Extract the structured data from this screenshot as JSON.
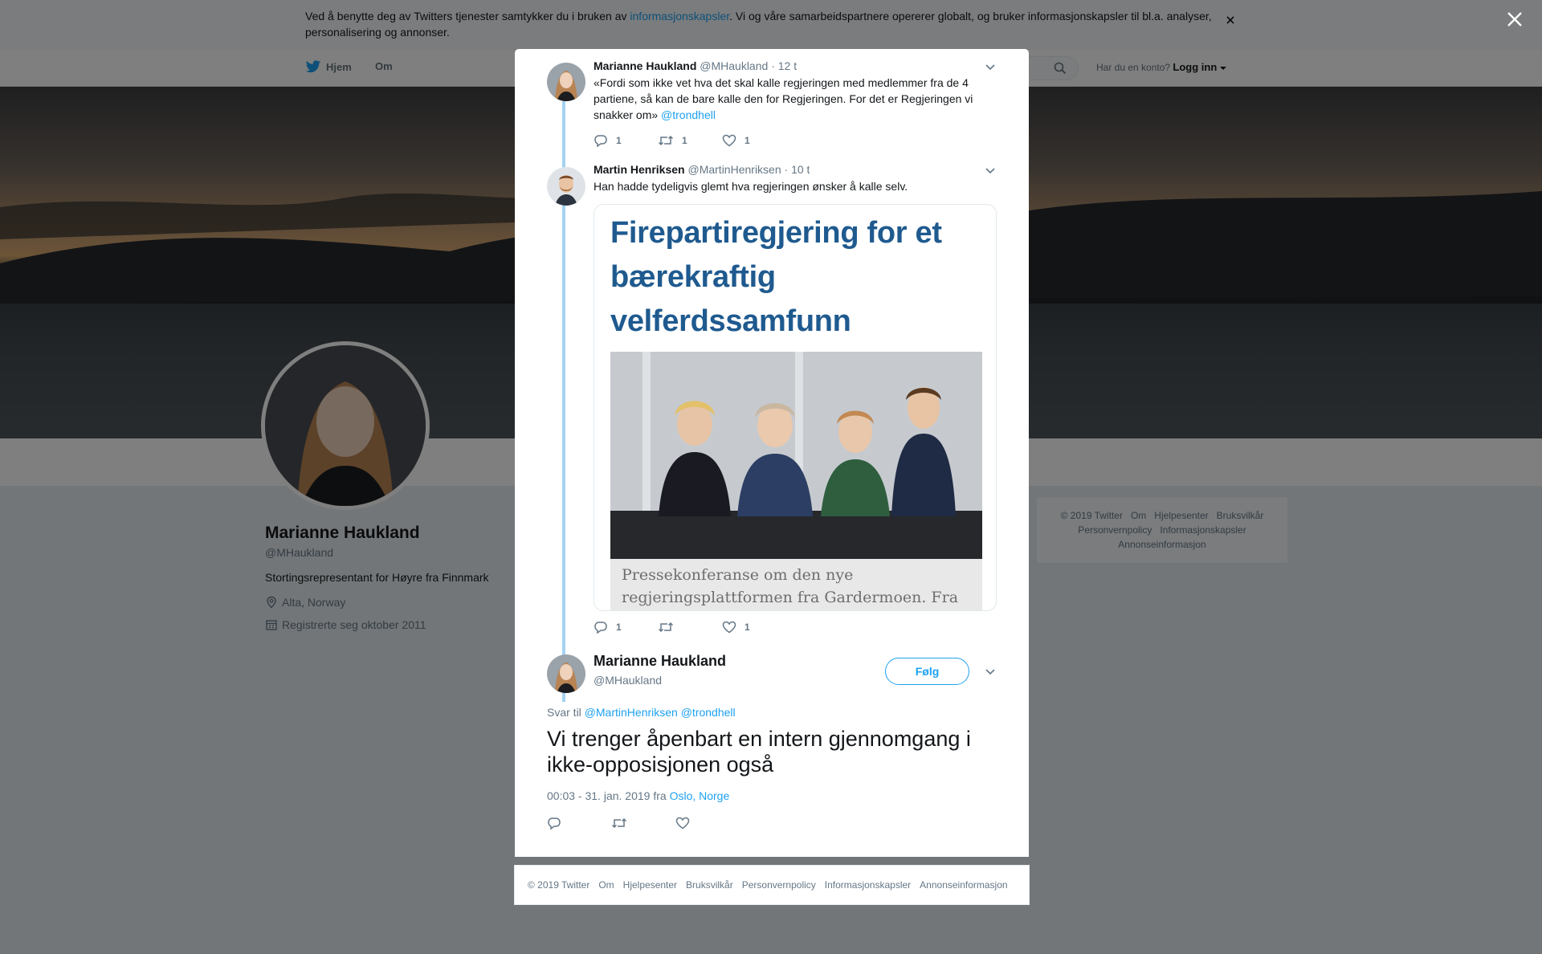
{
  "cookie": {
    "text_before": "Ved å benytte deg av Twitters tjenester samtykker du i bruken av ",
    "link": "informasjonskapsler",
    "text_after": ". Vi og våre samarbeidspartnere opererer globalt, og bruker informasjonskapsler til bl.a. analyser, personalisering og annonser."
  },
  "nav": {
    "home": "Hjem",
    "about": "Om",
    "login_prompt": "Har du en konto?",
    "login": "Logg inn"
  },
  "profile": {
    "name": "Marianne Haukland",
    "handle": "@MHaukland",
    "bio": "Stortingsrepresentant for Høyre fra Finnmark",
    "location": "Alta, Norway",
    "joined": "Registrerte seg oktober 2011"
  },
  "side_footer": [
    "© 2019 Twitter",
    "Om",
    "Hjelpesenter",
    "Bruksvilkår",
    "Personvernpolicy",
    "Informasjonskapsler",
    "Annonseinformasjon"
  ],
  "thread": {
    "tweet1": {
      "name": "Marianne Haukland",
      "handle": "@MHaukland",
      "time": "· 12 t",
      "text": "«Fordi som ikke vet hva det skal kalle regjeringen med medlemmer fra de 4 partiene, så kan de bare kalle den for Regjeringen. For det er Regjeringen vi snakker om» ",
      "mention": "@trondhell",
      "replies": "1",
      "retweets": "1",
      "likes": "1"
    },
    "tweet2": {
      "name": "Martin Henriksen",
      "handle": "@MartinHenriksen",
      "time": "· 10 t",
      "text": "Han hadde tydeligvis glemt hva regjeringen ønsker å kalle selv.",
      "card_title": "Firepartiregjering for et bærekraftig velferdssamfunn",
      "card_caption": "Pressekonferanse om den nye regjeringsplattformen fra Gardermoen. Fra",
      "replies": "1",
      "retweets": "",
      "likes": "1"
    },
    "main": {
      "name": "Marianne Haukland",
      "handle": "@MHaukland",
      "follow": "Følg",
      "reply_to_label": "Svar til",
      "reply_to": "@MartinHenriksen @trondhell",
      "text": "Vi trenger åpenbart en intern gjennomgang i ikke-opposisjonen også",
      "timestamp": "00:03 - 31. jan. 2019 fra",
      "place": "Oslo, Norge"
    }
  },
  "modal_footer": [
    "© 2019 Twitter",
    "Om",
    "Hjelpesenter",
    "Bruksvilkår",
    "Personvernpolicy",
    "Informasjonskapsler",
    "Annonseinformasjon"
  ],
  "colors": {
    "accent": "#1da1f2",
    "thread_line": "#a5d2f1",
    "text": "#14171a",
    "muted": "#657786"
  }
}
